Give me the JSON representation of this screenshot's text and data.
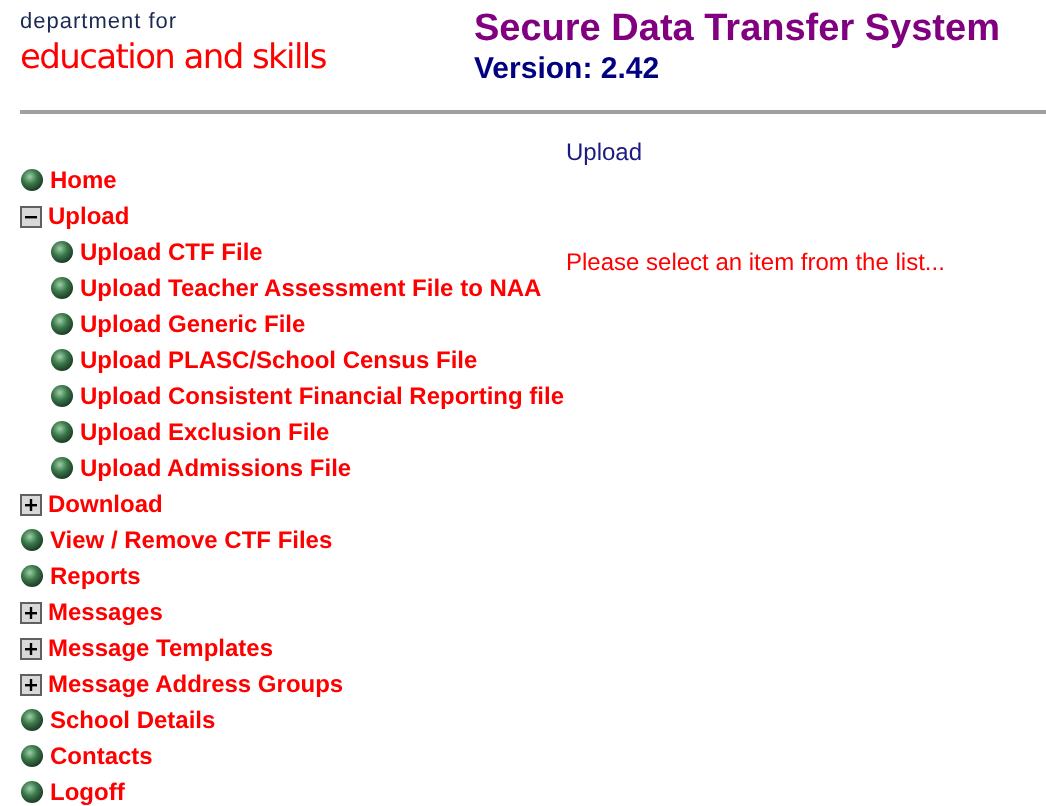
{
  "logo": {
    "line1": "department for",
    "line2": "education and skills"
  },
  "header": {
    "title": "Secure Data Transfer System",
    "version": "Version: 2.42"
  },
  "section_heading": "Upload",
  "message": "Please select an item from the list...",
  "menu": [
    {
      "kind": "leaf",
      "label": "Home"
    },
    {
      "kind": "folder",
      "label": "Upload",
      "expanded": true,
      "children": [
        {
          "kind": "leaf",
          "label": "Upload CTF File"
        },
        {
          "kind": "leaf",
          "label": "Upload Teacher Assessment File to NAA"
        },
        {
          "kind": "leaf",
          "label": "Upload Generic File"
        },
        {
          "kind": "leaf",
          "label": "Upload PLASC/School Census File"
        },
        {
          "kind": "leaf",
          "label": "Upload Consistent Financial Reporting file"
        },
        {
          "kind": "leaf",
          "label": "Upload Exclusion File"
        },
        {
          "kind": "leaf",
          "label": "Upload Admissions File"
        }
      ]
    },
    {
      "kind": "folder",
      "label": "Download",
      "expanded": false
    },
    {
      "kind": "leaf",
      "label": "View / Remove CTF Files"
    },
    {
      "kind": "leaf",
      "label": "Reports"
    },
    {
      "kind": "folder",
      "label": "Messages",
      "expanded": false
    },
    {
      "kind": "folder",
      "label": "Message Templates",
      "expanded": false
    },
    {
      "kind": "folder",
      "label": "Message Address Groups",
      "expanded": false
    },
    {
      "kind": "leaf",
      "label": "School Details"
    },
    {
      "kind": "leaf",
      "label": "Contacts"
    },
    {
      "kind": "leaf",
      "label": "Logoff"
    }
  ]
}
